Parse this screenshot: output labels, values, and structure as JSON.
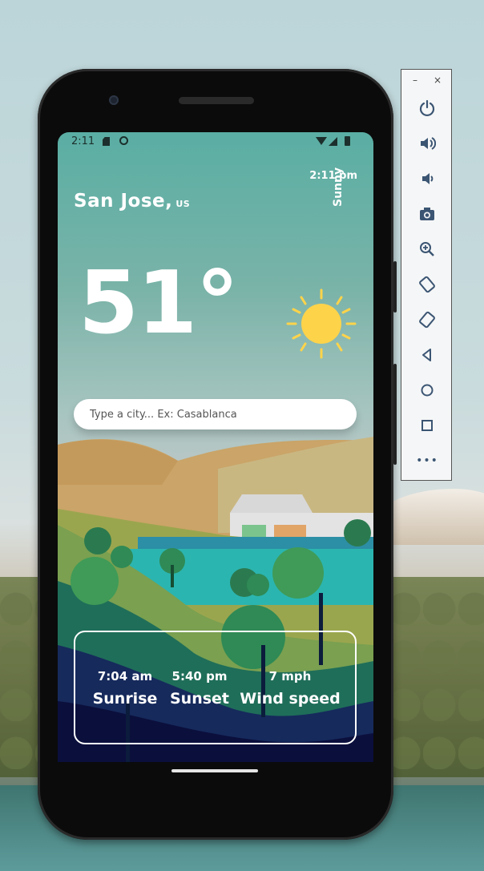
{
  "status_bar": {
    "time": "2:11"
  },
  "weather": {
    "local_time": "2:11 pm",
    "city": "San Jose,",
    "country": "US",
    "condition": "Sunny",
    "temperature": "51°"
  },
  "search": {
    "placeholder": "Type a city... Ex: Casablanca"
  },
  "stats": [
    {
      "value": "7:04 am",
      "label": "Sunrise"
    },
    {
      "value": "5:40 pm",
      "label": "Sunset"
    },
    {
      "value": "7 mph",
      "label": "Wind speed"
    }
  ],
  "toolbar": {
    "minimize": "–",
    "close": "×",
    "more": "•••"
  },
  "colors": {
    "sky_top": "#5aaea4",
    "sun": "#fdd34a",
    "icon": "#3b5573"
  }
}
